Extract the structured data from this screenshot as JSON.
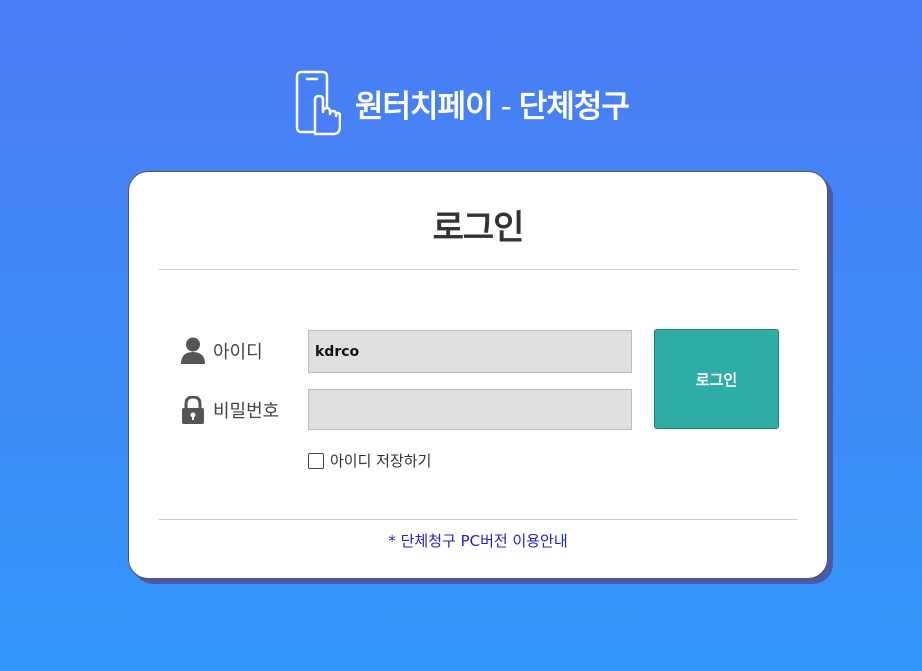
{
  "header": {
    "brand": "원터치페이",
    "separator": "-",
    "subtitle": "단체청구"
  },
  "login_card": {
    "title": "로그인",
    "id_label": "아이디",
    "id_value": "kdrco",
    "password_label": "비밀번호",
    "password_value": "",
    "login_button": "로그인",
    "remember_label": "아이디 저장하기",
    "remember_checked": false,
    "guide_link": "* 단체청구 PC버전 이용안내"
  },
  "colors": {
    "background": "#4a7cf5",
    "login_button": "#2eaca6",
    "input_background": "#e0e0e0",
    "link": "#2222cc"
  },
  "icons": {
    "logo": "phone-touch-icon",
    "id": "user-icon",
    "password": "lock-icon"
  }
}
